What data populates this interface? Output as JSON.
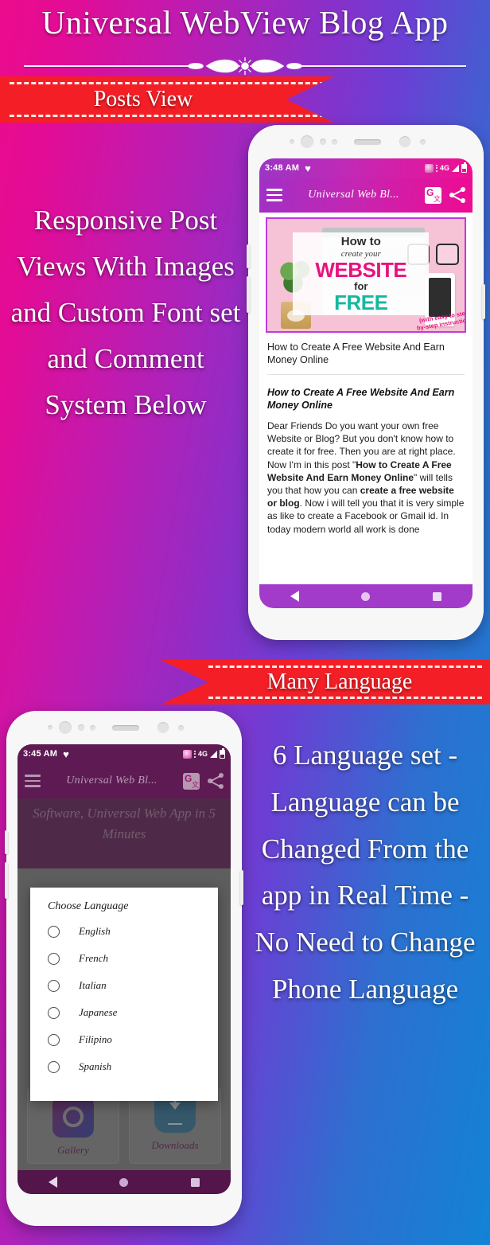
{
  "header": {
    "title": "Universal WebView Blog App"
  },
  "sections": [
    {
      "ribbon": "Posts View",
      "promo": "Responsive Post Views With Images and Custom Font set and Comment System Below"
    },
    {
      "ribbon": "Many Language",
      "promo": "6 Language set - Language can be Changed From the app in Real Time - No Need to Change Phone Language"
    }
  ],
  "phone_posts": {
    "status": {
      "time": "3:48 AM",
      "heart": "♥",
      "network": "4G"
    },
    "appbar": {
      "title": "Universal Web Bl...",
      "menu_icon": "hamburger-icon",
      "translate_icon": "google-translate-icon",
      "share_icon": "share-icon"
    },
    "featured_image": {
      "line1": "How to",
      "line2": "create your",
      "line3": "WEBSITE",
      "line4": "for",
      "line5": "FREE",
      "badge": "(with easy to step-by-step instructions)"
    },
    "post_title": "How to Create A Free Website And Earn Money Online",
    "post_heading": "How to Create A Free Website And Earn Money Online",
    "post_body_1": "Dear Friends Do you want your own free Website or Blog? But you don't know how to create it for free. Then you are at right place. Now I'm in this post \"",
    "post_body_bold_1": "How to Create A Free Website And Earn Money Online",
    "post_body_2": "\" will tells you that how you can ",
    "post_body_bold_2": "create a free website or blog",
    "post_body_3": ". Now i will tell you that it is very simple as like to create a Facebook or Gmail id. In today modern world all work is done",
    "navbar": {
      "back": "back-button",
      "home": "home-button",
      "recents": "recents-button"
    }
  },
  "phone_language": {
    "status": {
      "time": "3:45 AM",
      "heart": "♥",
      "network": "4G"
    },
    "appbar": {
      "title": "Universal Web Bl...",
      "menu_icon": "hamburger-icon",
      "translate_icon": "google-translate-icon",
      "share_icon": "share-icon"
    },
    "hero_text": "Software, Universal Web App in 5 Minutes",
    "dialog": {
      "title": "Choose Language",
      "options": [
        {
          "label": "English",
          "selected": false
        },
        {
          "label": "French",
          "selected": false
        },
        {
          "label": "Italian",
          "selected": false
        },
        {
          "label": "Japanese",
          "selected": false
        },
        {
          "label": "Filipino",
          "selected": false
        },
        {
          "label": "Spanish",
          "selected": false
        }
      ]
    },
    "tiles": [
      {
        "label": "Gallery",
        "icon": "gallery-icon"
      },
      {
        "label": "Downloads",
        "icon": "download-icon"
      }
    ],
    "navbar": {
      "back": "back-button",
      "home": "home-button",
      "recents": "recents-button"
    }
  },
  "colors": {
    "ribbon": "#f41f26",
    "gradient_start": "#ec0b8c",
    "gradient_mid": "#8b2fc9",
    "gradient_end": "#1283d6",
    "appbar_pink": "#f00a92",
    "nav_purple": "#a23bc9"
  }
}
